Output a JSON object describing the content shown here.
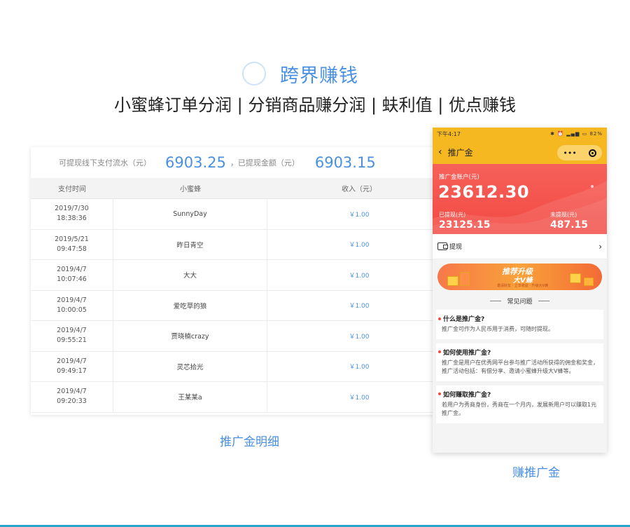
{
  "header": {
    "title": "跨界赚钱",
    "subtitle": "小蜜蜂订单分润 | 分销商品赚分润 | 蚨利值 | 优点赚钱"
  },
  "summary": {
    "label1": "可提现线下支付流水（元）",
    "value1": "6903.25",
    "label2": "，已提现金额（元）",
    "value2": "6903.15"
  },
  "table": {
    "headers": [
      "支付时间",
      "小蜜蜂",
      "收入（元）"
    ],
    "rows": [
      {
        "date": "2019/7/30",
        "time": "18:38:36",
        "name": "SunnyDay",
        "amount": "￥1.00"
      },
      {
        "date": "2019/5/21",
        "time": "09:47:58",
        "name": "昨日青空",
        "amount": "￥1.00"
      },
      {
        "date": "2019/4/7",
        "time": "10:07:46",
        "name": "大大",
        "amount": "￥1.00"
      },
      {
        "date": "2019/4/7",
        "time": "10:00:05",
        "name": "爱吃草的狼",
        "amount": "￥1.00"
      },
      {
        "date": "2019/4/7",
        "time": "09:55:21",
        "name": "贾晓楠crazy",
        "amount": "￥1.00"
      },
      {
        "date": "2019/4/7",
        "time": "09:49:17",
        "name": "灵芯拾光",
        "amount": "￥1.00"
      },
      {
        "date": "2019/4/7",
        "time": "09:20:33",
        "name": "王某某a",
        "amount": "￥1.00"
      }
    ]
  },
  "captions": {
    "left": "推广金明细",
    "right": "赚推广金"
  },
  "phone": {
    "status_time": "下午4:17",
    "status_battery": "82%",
    "nav_title": "推广金",
    "capsule_dots": "•••",
    "account_label": "推广金账户(元)",
    "account_value": "23612.30",
    "withdrawn_label": "已提现(元)",
    "withdrawn_value": "23125.15",
    "pending_label": "未提现(元)",
    "pending_value": "487.15",
    "withdraw_label": "提现",
    "banner_line1": "推荐升级",
    "banner_line2": "大V蜂",
    "banner_small": "邀请好友 · 立享收益 · 升级大V蜂",
    "faq_title": "常见问题",
    "faq": [
      {
        "q": "什么是推广金?",
        "a": "推广金可作为人民币用于消费，可随时提现。"
      },
      {
        "q": "如何使用推广金?",
        "a": "推广金是用户在优秀网平台参与推广活动所获得的佣金和奖金，推广活动包括：有偿分享、邀请小蜜蜂升级大V蜂等。"
      },
      {
        "q": "如何赚取推广金?",
        "a": "若用户为秀商身份，秀商在一个月内，发展新用户可以赚取1元推广金。"
      }
    ]
  },
  "colors": {
    "accent": "#4a90e2",
    "phone_bar": "#f5b820",
    "balance_red": "#f24a43"
  }
}
